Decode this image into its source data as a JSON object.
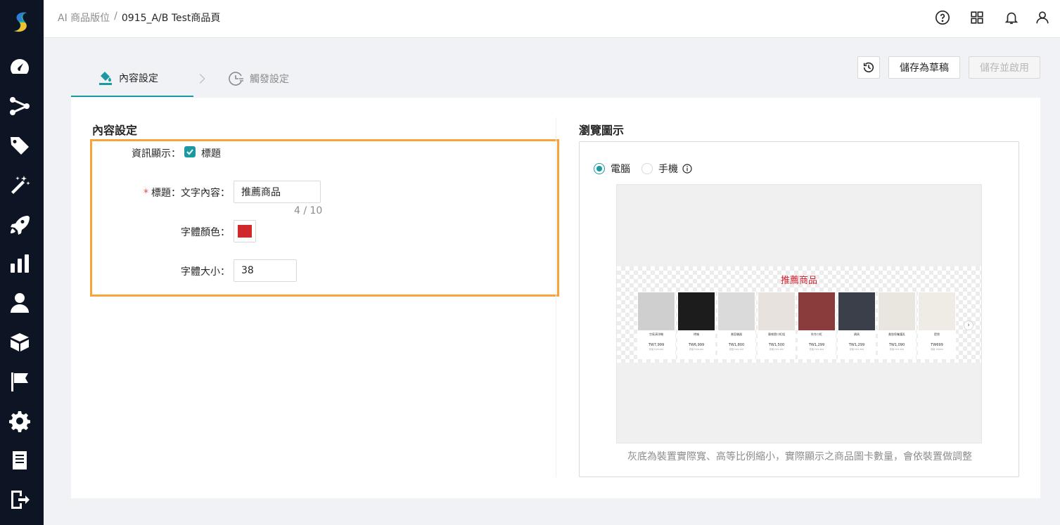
{
  "breadcrumb": {
    "parent": "AI 商品版位",
    "separator": "/",
    "current": "0915_A/B Test商品頁"
  },
  "header_icons": [
    "help-icon",
    "apps-grid-icon",
    "bell-icon",
    "user-icon"
  ],
  "sidebar_icons": [
    "dashboard-icon",
    "flow-icon",
    "tag-icon",
    "magic-wand-icon",
    "rocket-icon",
    "bar-chart-icon",
    "person-icon",
    "box-icon",
    "flag-icon",
    "gear-icon",
    "notebook-icon",
    "logout-icon"
  ],
  "steps": {
    "content": "內容設定",
    "trigger": "觸發設定"
  },
  "toolbar": {
    "save_draft": "儲存為草稿",
    "save_publish": "儲存並啟用"
  },
  "form": {
    "section_title": "內容設定",
    "info_display_label": "資訊顯示：",
    "title_checkbox_label": "標題",
    "title_checked": true,
    "title_label": "標題：",
    "text_content_label": "文字內容：",
    "text_value": "推薦商品",
    "char_count": "4 / 10",
    "font_color_label": "字體顏色：",
    "font_color": "#d0292c",
    "font_size_label": "字體大小：",
    "font_size_value": "38"
  },
  "preview": {
    "section_title": "瀏覽圖示",
    "device_desktop": "電腦",
    "device_mobile": "手機",
    "selected_device": "desktop",
    "strip_title": "推薦商品",
    "note": "灰底為裝置實際寬、高等比例縮小，實際顯示之商品圖卡數量，會依裝置做調整",
    "products": [
      {
        "name": "空氣清淨機",
        "price": "TW7,999",
        "old": "原價 TW8,999",
        "color": "#cfcfcf"
      },
      {
        "name": "烤箱",
        "price": "TW6,999",
        "old": "原價 TW8,999",
        "color": "#1c1c1c"
      },
      {
        "name": "美容儀器",
        "price": "TW1,800",
        "old": "原價 TW2,400",
        "color": "#dadada"
      },
      {
        "name": "霧感唇口紅組",
        "price": "TW1,500",
        "old": "原價 TW1,900",
        "color": "#e7e2dd"
      },
      {
        "name": "秋冬口紅",
        "price": "TW1,299",
        "old": "原價 TW1,899",
        "color": "#8a3b3b"
      },
      {
        "name": "鍋具",
        "price": "TW1,299",
        "old": "原價 TW1,899",
        "color": "#3a3f4a"
      },
      {
        "name": "美妝保養護乳",
        "price": "TW1,090",
        "old": "原價 TW1,690",
        "color": "#e9e6df"
      },
      {
        "name": "提袋",
        "price": "TW699",
        "old": "原價 TW899",
        "color": "#efece6"
      }
    ]
  }
}
